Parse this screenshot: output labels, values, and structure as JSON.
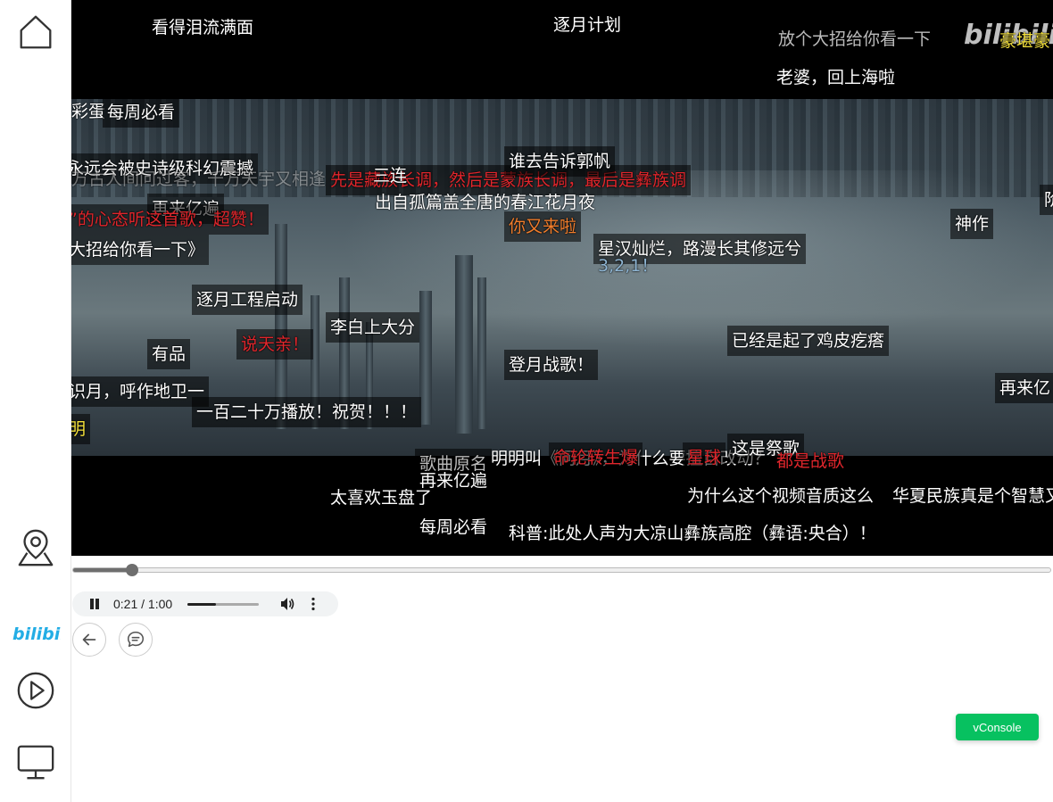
{
  "player": {
    "current_time": "0:21",
    "duration": "1:00",
    "time_display": "0:21 / 1:00",
    "progress_fraction": 0.06,
    "volume_fraction": 0.4,
    "watermark": "bilibili"
  },
  "sidebar": {
    "items": [
      {
        "name": "home",
        "icon": "home-icon"
      },
      {
        "name": "location",
        "icon": "location-pin-icon"
      },
      {
        "name": "bilibili",
        "icon": "bilibili-logo-icon",
        "label": "bilibili"
      },
      {
        "name": "play",
        "icon": "play-circle-icon"
      },
      {
        "name": "monitor",
        "icon": "monitor-icon"
      }
    ]
  },
  "actions": {
    "back_icon": "arrow-left-icon",
    "danmaku_icon": "comment-icon"
  },
  "vconsole": {
    "label": "vConsole"
  },
  "colors": {
    "red": "#e0262c",
    "orange": "#f07d2c",
    "yellow": "#f4e13c",
    "vconsole_green": "#07c160"
  },
  "danmaku": [
    {
      "text": "看得泪流满面"
    },
    {
      "text": "逐月计划"
    },
    {
      "text": "放个大招给你看一下"
    },
    {
      "text": "豪堪豪"
    },
    {
      "text": "老婆，回上海啦"
    },
    {
      "text": "彩蛋"
    },
    {
      "text": "每周必看"
    },
    {
      "text": "永远会被史诗级科幻震撼"
    },
    {
      "text": "万古人间问过客，千万天宇又相逢"
    },
    {
      "text": "先是藏族长调，然后是蒙族长调，最后是彝族调"
    },
    {
      "text": "三连"
    },
    {
      "text": "谁去告诉郭帆"
    },
    {
      "text": "出自孤篇盖全唐的春江花月夜"
    },
    {
      "text": "再来亿遍"
    },
    {
      "text": "”的心态听这首歌，超赞！"
    },
    {
      "text": "你又来啦"
    },
    {
      "text": "神作"
    },
    {
      "text": "阶"
    },
    {
      "text": "大招给你看一下》"
    },
    {
      "text": "星汉灿烂，路漫长其修远兮"
    },
    {
      "text": "3,2,1！"
    },
    {
      "text": "逐月工程启动"
    },
    {
      "text": "李白上大分"
    },
    {
      "text": "说天亲！"
    },
    {
      "text": "有品"
    },
    {
      "text": "已经是起了鸡皮疙瘩"
    },
    {
      "text": "登月战歌！"
    },
    {
      "text": "识月，呼作地卫一"
    },
    {
      "text": "再来亿"
    },
    {
      "text": "一百二十万播放！祝贺！！！"
    },
    {
      "text": "明"
    },
    {
      "text": "歌曲原名"
    },
    {
      "text": "明明叫《问月》，为什么要擅自改动？"
    },
    {
      "text": "命轮转生爆"
    },
    {
      "text": "星球"
    },
    {
      "text": "这是祭歌"
    },
    {
      "text": "都是战歌"
    },
    {
      "text": "再来亿遍"
    },
    {
      "text": "太喜欢玉盘了"
    },
    {
      "text": "为什么这个视频音质这么"
    },
    {
      "text": "华夏民族真是个智慧又混"
    },
    {
      "text": "每周必看"
    },
    {
      "text": "科普:此处人声为大凉山彝族高腔（彝语:央合）！"
    }
  ]
}
